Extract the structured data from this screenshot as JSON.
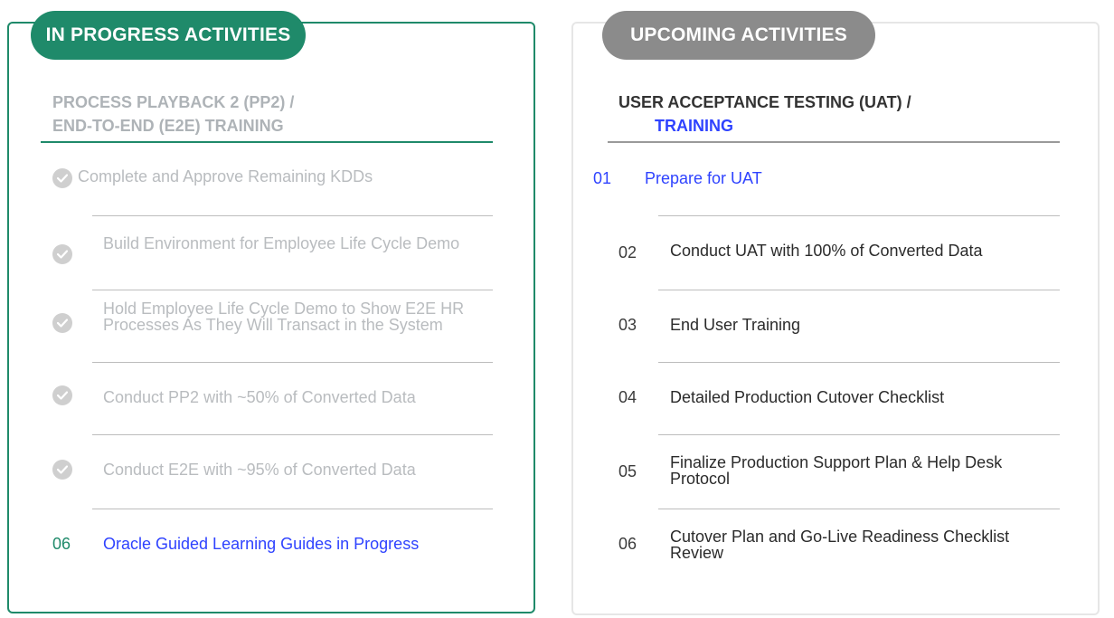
{
  "left": {
    "pill": "IN PROGRESS ACTIVITIES",
    "title_line1": "PROCESS PLAYBACK 2 (PP2) /",
    "title_line2": "END-TO-END (E2E) TRAINING",
    "items": [
      {
        "label": "Complete and Approve Remaining KDDs"
      },
      {
        "label": "Build Environment for Employee Life Cycle Demo"
      },
      {
        "label": "Hold Employee Life Cycle Demo to Show E2E HR Processes As They Will Transact in the System"
      },
      {
        "label": "Conduct PP2 with ~50% of Converted Data"
      },
      {
        "label": "Conduct E2E with ~95% of Converted Data"
      },
      {
        "number": "06",
        "label": "Oracle Guided Learning Guides in Progress"
      }
    ]
  },
  "right": {
    "pill": "UPCOMING ACTIVITIES",
    "title_line1": "USER ACCEPTANCE TESTING (UAT) /",
    "title_line2": "TRAINING",
    "items": [
      {
        "number": "01",
        "label": "Prepare for UAT"
      },
      {
        "number": "02",
        "label": "Conduct UAT with 100% of Converted Data"
      },
      {
        "number": "03",
        "label": "End User Training"
      },
      {
        "number": "04",
        "label": "Detailed Production Cutover Checklist"
      },
      {
        "number": "05",
        "label": "Finalize Production Support Plan & Help Desk Protocol"
      },
      {
        "number": "06",
        "label": "Cutover Plan and Go-Live Readiness Checklist Review"
      }
    ]
  },
  "colors": {
    "green": "#1f8a6a",
    "gray": "#8b8b8b",
    "blue_accent": "#2f43ff"
  }
}
